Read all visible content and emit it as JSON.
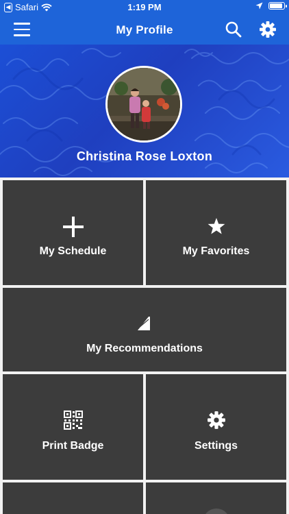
{
  "status_bar": {
    "carrier": "Safari",
    "time": "1:19 PM",
    "battery_level": 0.9
  },
  "navbar": {
    "title": "My Profile",
    "menu_icon": "hamburger-icon",
    "search_icon": "search-icon",
    "settings_icon": "gear-icon"
  },
  "profile": {
    "name": "Christina Rose Loxton"
  },
  "tiles": [
    {
      "label": "My Schedule",
      "icon": "plus-icon"
    },
    {
      "label": "My Favorites",
      "icon": "star-icon"
    },
    {
      "label": "My Recommendations",
      "icon": "recommendations-icon"
    },
    {
      "label": "Print Badge",
      "icon": "qr-code-icon"
    },
    {
      "label": "Settings",
      "icon": "gear-icon"
    }
  ],
  "colors": {
    "brand_blue": "#1e64d9",
    "tile_gray": "#3c3c3c",
    "background": "#f2f2f2"
  }
}
